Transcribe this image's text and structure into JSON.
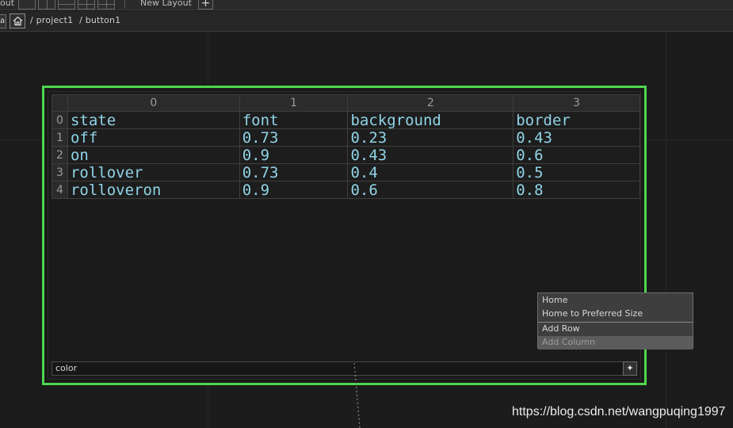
{
  "topbar": {
    "cut_label": "out",
    "new_layout_label": "New Layout",
    "add_layout_label": "+"
  },
  "pathbar": {
    "back_glyph": "ar",
    "crumbs": [
      "/ project1",
      "/ button1"
    ]
  },
  "table": {
    "col_headers": [
      "0",
      "1",
      "2",
      "3"
    ],
    "row_indices": [
      "0",
      "1",
      "2",
      "3",
      "4"
    ],
    "rows": [
      [
        "state",
        "font",
        "background",
        "border"
      ],
      [
        "off",
        "0.73",
        "0.23",
        "0.43"
      ],
      [
        "on",
        "0.9",
        "0.43",
        "0.6"
      ],
      [
        "rollover",
        "0.73",
        "0.4",
        "0.5"
      ],
      [
        "rolloveron",
        "0.9",
        "0.6",
        "0.8"
      ]
    ]
  },
  "command_field": {
    "value": "color",
    "button_glyph": "✦"
  },
  "context_menu": {
    "items": [
      {
        "label": "Home",
        "enabled": true
      },
      {
        "label": "Home to Preferred Size",
        "enabled": true
      },
      {
        "label": "Add Row",
        "enabled": true
      },
      {
        "label": "Add Column",
        "enabled": false
      }
    ]
  },
  "watermark": "https://blog.csdn.net/wangpuqing1997",
  "colors": {
    "node_border": "#4fd64f",
    "cell_text": "#8fd3e6",
    "background": "#1c1c1c"
  },
  "icons": [
    "home-icon",
    "plus-icon",
    "layout-icon"
  ]
}
